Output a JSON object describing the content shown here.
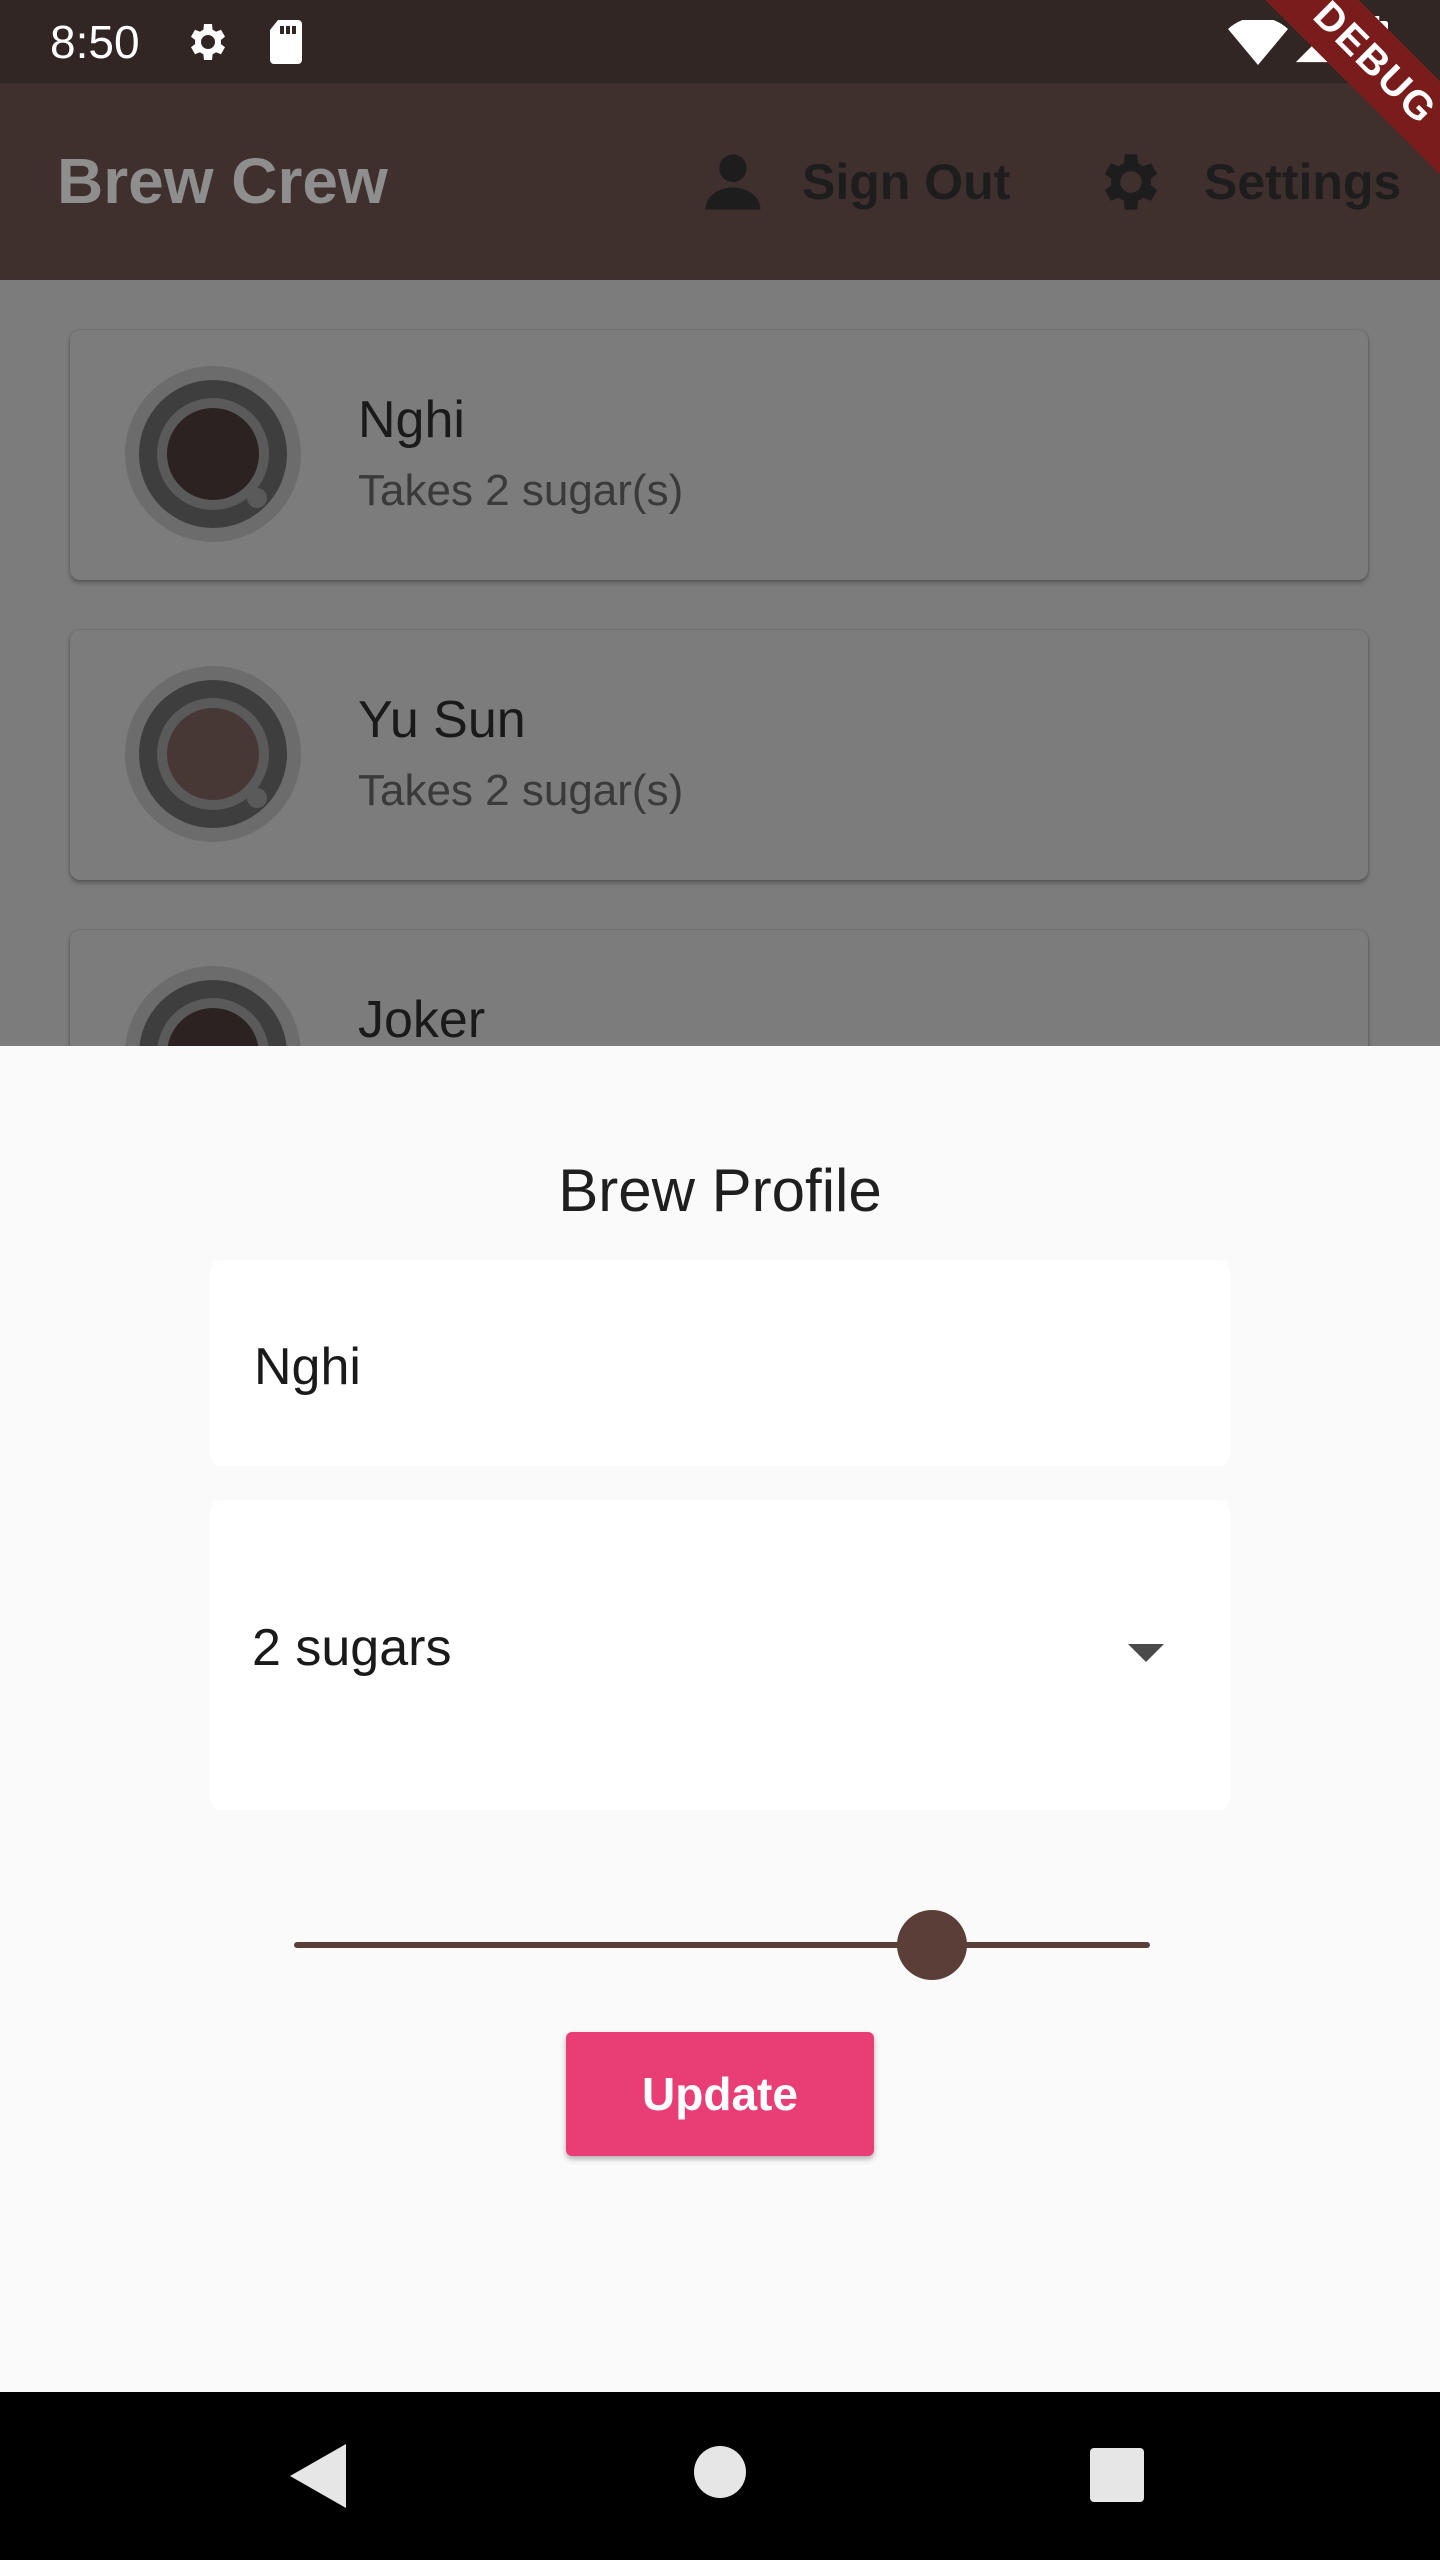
{
  "status_bar": {
    "time": "8:50"
  },
  "debug_banner": "DEBUG",
  "app_bar": {
    "title": "Brew Crew",
    "sign_out_label": "Sign Out",
    "settings_label": "Settings"
  },
  "list": [
    {
      "name": "Nghi",
      "subtitle": "Takes 2 sugar(s)"
    },
    {
      "name": "Yu Sun",
      "subtitle": "Takes 2 sugar(s)"
    },
    {
      "name": "Joker",
      "subtitle": ""
    }
  ],
  "sheet": {
    "title": "Brew Profile",
    "name_value": "Nghi",
    "sugars_selected": "2 sugars",
    "strength_fraction": 0.745,
    "update_label": "Update"
  },
  "colors": {
    "accent": "#e83e75",
    "brown": "#5b3e38",
    "app_bar": "#3f302e"
  },
  "icons": {
    "status": [
      "gear-icon",
      "sd-card-icon",
      "wifi-icon",
      "signal-icon",
      "battery-icon"
    ],
    "app_bar": [
      "person-icon",
      "settings-icon"
    ],
    "nav": [
      "back-icon",
      "home-icon",
      "recents-icon"
    ]
  }
}
